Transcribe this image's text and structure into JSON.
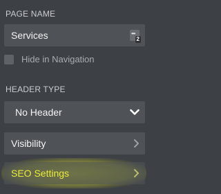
{
  "page_name": {
    "label": "PAGE NAME",
    "value": "Services",
    "badge_number": "2"
  },
  "hide_in_navigation": {
    "label": "Hide in Navigation",
    "checked": false
  },
  "header_type": {
    "label": "HEADER TYPE",
    "selected": "No Header"
  },
  "visibility": {
    "label": "Visibility"
  },
  "seo_settings": {
    "label": "SEO Settings",
    "label_color": "#e4e62a"
  },
  "colors": {
    "background": "#3d4044",
    "field": "#4f5358",
    "highlight": "#e1e428"
  }
}
